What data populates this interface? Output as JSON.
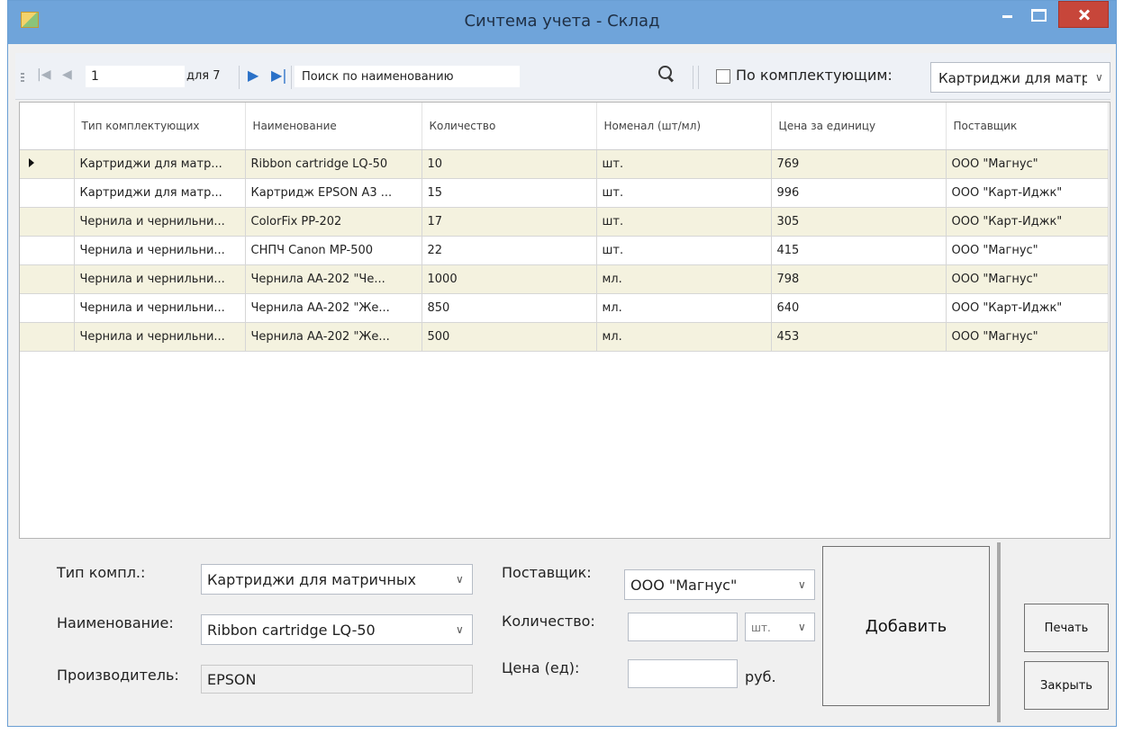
{
  "window": {
    "title": "Сичтема учета - Склад"
  },
  "toolbar": {
    "position_value": "1",
    "count_label": "для 7",
    "search_value": "Поиск по наименованию",
    "filter_checkbox_label": "По комплектующим:",
    "filter_combo_value": "Картриджи для матричных"
  },
  "grid": {
    "columns": [
      "Тип комплектующих",
      "Наименование",
      "Количество",
      "Номенал (шт/мл)",
      "Цена за единицу",
      "Поставщик"
    ],
    "rows": [
      [
        "Картриджи для матр...",
        "Ribbon cartridge LQ-50",
        "10",
        "шт.",
        "769",
        "ООО \"Магнус\""
      ],
      [
        "Картриджи для матр...",
        "Картридж EPSON A3 ...",
        "15",
        "шт.",
        "996",
        "ООО \"Карт-Иджк\""
      ],
      [
        "Чернила и чернильни...",
        "ColorFix PP-202",
        "17",
        "шт.",
        "305",
        "ООО \"Карт-Иджк\""
      ],
      [
        "Чернила и чернильни...",
        "СНПЧ Canon MP-500",
        "22",
        "шт.",
        "415",
        "ООО \"Магнус\""
      ],
      [
        "Чернила и чернильни...",
        "Чернила АА-202 \"Че...",
        "1000",
        "мл.",
        "798",
        "ООО \"Магнус\""
      ],
      [
        "Чернила и чернильни...",
        "Чернила АА-202 \"Же...",
        "850",
        "мл.",
        "640",
        "ООО \"Карт-Иджк\""
      ],
      [
        "Чернила и чернильни...",
        "Чернила АА-202 \"Же...",
        "500",
        "мл.",
        "453",
        "ООО \"Магнус\""
      ]
    ]
  },
  "form": {
    "type_label": "Тип компл.:",
    "type_value": "Картриджи для матричных",
    "name_label": "Наименование:",
    "name_value": "Ribbon cartridge LQ-50",
    "maker_label": "Производитель:",
    "maker_value": "EPSON",
    "supplier_label": "Поставщик:",
    "supplier_value": "ООО \"Магнус\"",
    "qty_label": "Количество:",
    "qty_value": "",
    "unit_value": "шт.",
    "price_label": "Цена (ед):",
    "price_value": "",
    "currency_label": "руб."
  },
  "buttons": {
    "add": "Добавить",
    "print": "Печать",
    "close": "Закрыть"
  }
}
